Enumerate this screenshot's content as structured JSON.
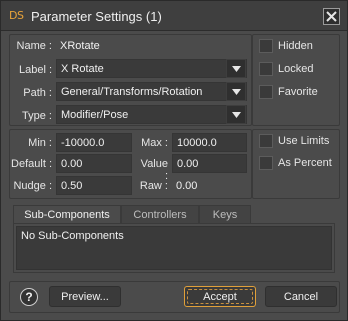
{
  "window": {
    "logo": "DS",
    "title": "Parameter Settings (1)"
  },
  "identity": {
    "name_label": "Name :",
    "name_value": "XRotate",
    "label_label": "Label :",
    "label_value": "X Rotate",
    "path_label": "Path :",
    "path_value": "General/Transforms/Rotation",
    "type_label": "Type :",
    "type_value": "Modifier/Pose"
  },
  "flags": {
    "hidden": "Hidden",
    "locked": "Locked",
    "favorite": "Favorite"
  },
  "limits": {
    "min_label": "Min :",
    "min_value": "-10000.0",
    "max_label": "Max :",
    "max_value": "10000.0",
    "default_label": "Default :",
    "default_value": "0.00",
    "value_label": "Value :",
    "value_value": "0.00",
    "nudge_label": "Nudge :",
    "nudge_value": "0.50",
    "raw_label": "Raw :",
    "raw_value": "0.00"
  },
  "limit_options": {
    "use_limits": "Use Limits",
    "as_percent": "As Percent"
  },
  "tabs": [
    {
      "label": "Sub-Components"
    },
    {
      "label": "Controllers"
    },
    {
      "label": "Keys"
    }
  ],
  "subcomponents": {
    "empty_text": "No Sub-Components"
  },
  "footer": {
    "help": "?",
    "preview": "Preview...",
    "accept": "Accept",
    "cancel": "Cancel"
  },
  "colors": {
    "accent": "#e0a03a",
    "background": "#4b4b4b",
    "field": "#3a3a3a"
  },
  "icons": {
    "close": "close-icon",
    "dropdown": "chevron-down-icon",
    "help": "help-icon"
  }
}
